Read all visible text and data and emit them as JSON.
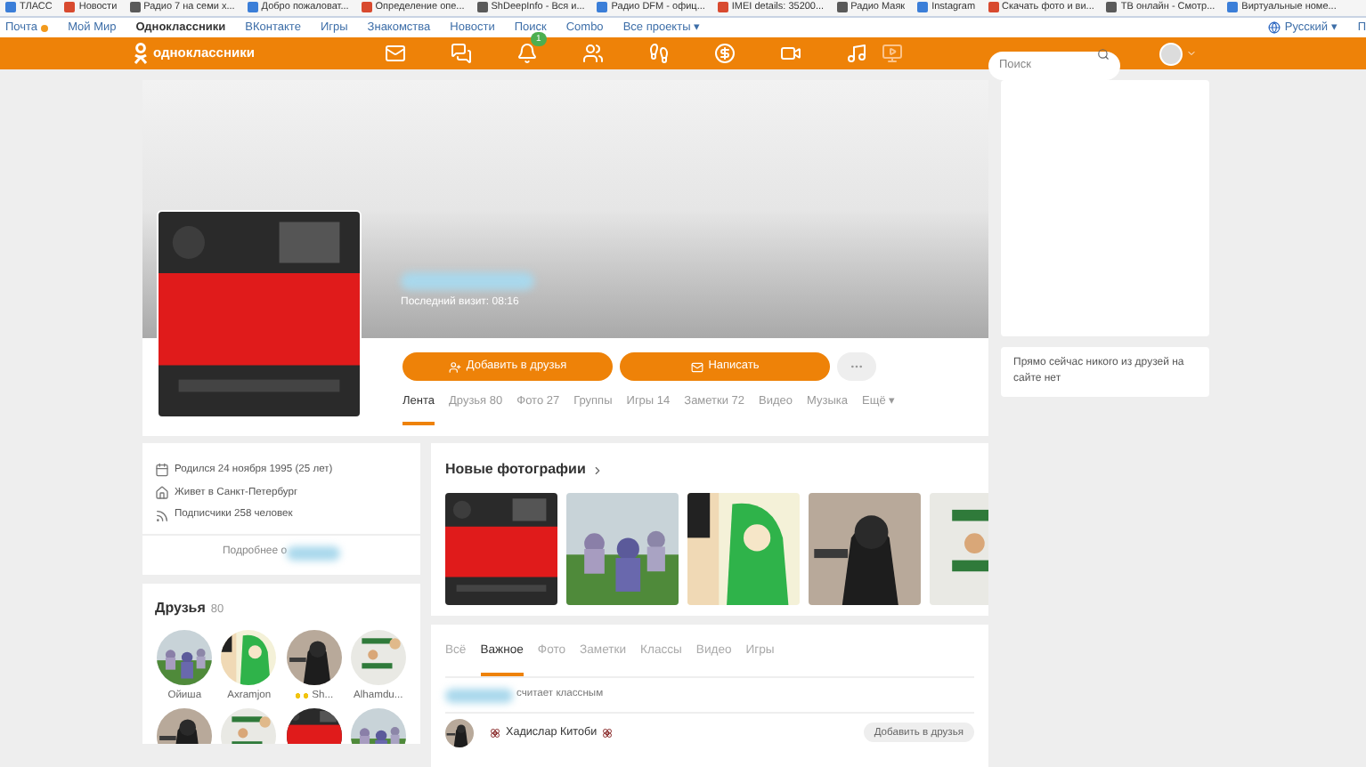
{
  "bookmarks": [
    {
      "label": "ТЛАСС"
    },
    {
      "label": "Новости"
    },
    {
      "label": "Радио 7 на семи х..."
    },
    {
      "label": "Добро пожаловат..."
    },
    {
      "label": "Определение опе..."
    },
    {
      "label": "ShDeepInfo - Вся и..."
    },
    {
      "label": "Радио DFM - офиц..."
    },
    {
      "label": "IMEI details: 35200..."
    },
    {
      "label": "Радио Маяк"
    },
    {
      "label": "Instagram"
    },
    {
      "label": "Скачать фото и ви..."
    },
    {
      "label": "ТВ онлайн - Смотр..."
    },
    {
      "label": "Виртуальные номе..."
    }
  ],
  "nav_links": [
    {
      "label": "Почта",
      "selected": false
    },
    {
      "label": "Мой Мир",
      "selected": false
    },
    {
      "label": "Одноклассники",
      "selected": true
    },
    {
      "label": "ВКонтакте",
      "selected": false
    },
    {
      "label": "Игры",
      "selected": false
    },
    {
      "label": "Знакомства",
      "selected": false
    },
    {
      "label": "Новости",
      "selected": false
    },
    {
      "label": "Поиск",
      "selected": false
    },
    {
      "label": "Combo",
      "selected": false
    },
    {
      "label": "Все проекты ▾",
      "selected": false
    }
  ],
  "language": "Русский ▾",
  "language_next": "П",
  "header": {
    "logo": "одноклассники",
    "notifications_badge": "1",
    "search": {
      "placeholder": "Поиск"
    }
  },
  "profile": {
    "last_visit": "Последний визит: 08:16",
    "add_button": "Добавить в друзья",
    "write_button": "Написать",
    "tabs": [
      {
        "label": "Лента",
        "selected": true
      },
      {
        "label": "Друзья 80",
        "selected": false
      },
      {
        "label": "Фото 27",
        "selected": false
      },
      {
        "label": "Группы",
        "selected": false
      },
      {
        "label": "Игры 14",
        "selected": false
      },
      {
        "label": "Заметки 72",
        "selected": false
      },
      {
        "label": "Видео",
        "selected": false
      },
      {
        "label": "Музыка",
        "selected": false
      },
      {
        "label": "Ещё ▾",
        "selected": false
      }
    ]
  },
  "info": {
    "rows": [
      {
        "kind": "birthday",
        "text": "Родился 24 ноября 1995 (25 лет)"
      },
      {
        "kind": "home",
        "text": "Живет в Санкт-Петербург"
      },
      {
        "kind": "subscribers",
        "text": "Подписчики 258 человек"
      }
    ],
    "more": "Подробнее о"
  },
  "friends": {
    "title": "Друзья",
    "count": "80",
    "items": [
      {
        "name": "Ойиша"
      },
      {
        "name": "Axramjon"
      },
      {
        "name": "Sh..."
      },
      {
        "name": "Alhamdu..."
      }
    ]
  },
  "photos": {
    "title": "Новые фотографии"
  },
  "feed": {
    "tabs": [
      {
        "label": "Всё",
        "selected": false
      },
      {
        "label": "Важное",
        "selected": true
      },
      {
        "label": "Фото",
        "selected": false
      },
      {
        "label": "Заметки",
        "selected": false
      },
      {
        "label": "Классы",
        "selected": false
      },
      {
        "label": "Видео",
        "selected": false
      },
      {
        "label": "Игры",
        "selected": false
      }
    ],
    "likes_text": "считает классным",
    "author": "Хадислар Китоби",
    "add_button": "Добавить в друзья"
  },
  "online": {
    "text": "Прямо сейчас никого из друзей на сайте нет"
  }
}
